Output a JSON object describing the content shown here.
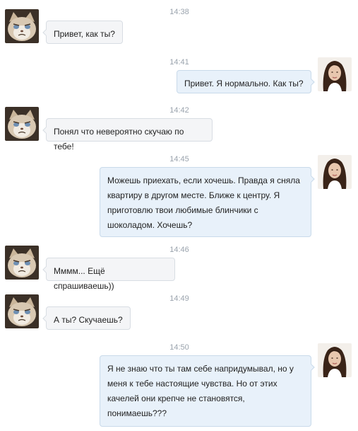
{
  "messages": [
    {
      "time": "14:38",
      "text": "Привет, как ты?"
    },
    {
      "time": "14:41",
      "text": "Привет. Я нормально. Как ты?"
    },
    {
      "time": "14:42",
      "text": "Понял что невероятно скучаю по тебе!"
    },
    {
      "time": "14:45",
      "text": "Можешь приехать, если хочешь. Правда я сняла квартиру в другом месте. Ближе к центру. Я приготовлю твои любимые блинчики с шоколадом. Хочешь?"
    },
    {
      "time": "14:46",
      "text": "Мммм... Ещё спрашиваешь))"
    },
    {
      "time": "14:49",
      "text": "А ты? Скучаешь?"
    },
    {
      "time": "14:50",
      "text": "Я не знаю что ты там себе напридумывал, но у меня к тебе настоящие чувства. Но от этих качелей они крепче не становятся, понимаешь???"
    }
  ],
  "avatars": {
    "left_icon": "grumpy-cat-avatar",
    "right_icon": "woman-avatar"
  }
}
